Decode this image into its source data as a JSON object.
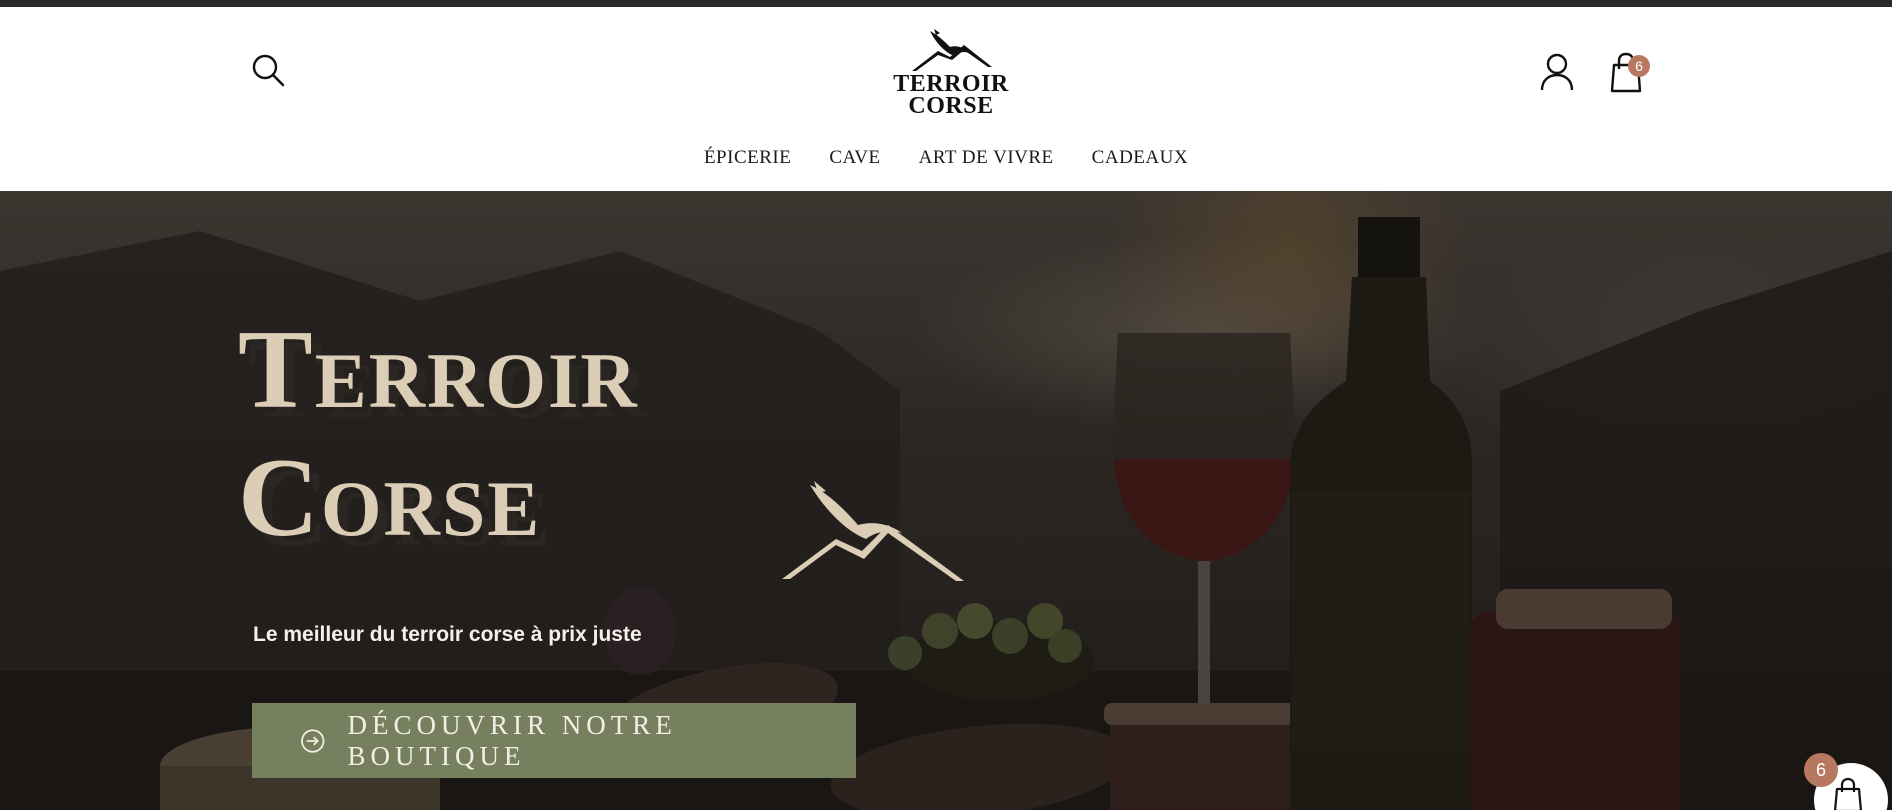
{
  "header": {
    "logo_line1": "TERROIR",
    "logo_line2": "CORSE",
    "cart_count": "6"
  },
  "nav": {
    "items": [
      {
        "label": "ÉPICERIE"
      },
      {
        "label": "CAVE"
      },
      {
        "label": "ART DE VIVRE"
      },
      {
        "label": "CADEAUX"
      }
    ]
  },
  "hero": {
    "title_line1": "Terroir",
    "title_line2": "Corse",
    "tagline": "Le meilleur du terroir corse à prix juste",
    "cta_label": "DÉCOUVRIR NOTRE BOUTIQUE"
  },
  "floating_cart": {
    "count": "6"
  },
  "icons": {
    "search": "search-icon",
    "account": "user-icon",
    "cart": "shopping-bag-icon",
    "cta": "arrow-circle-right-icon",
    "logo": "eagle-mountain-icon"
  },
  "colors": {
    "topbar": "#2a2a2a",
    "badge": "#b87860",
    "cta_background": "#76805f",
    "hero_title": "#dbcdb6"
  }
}
